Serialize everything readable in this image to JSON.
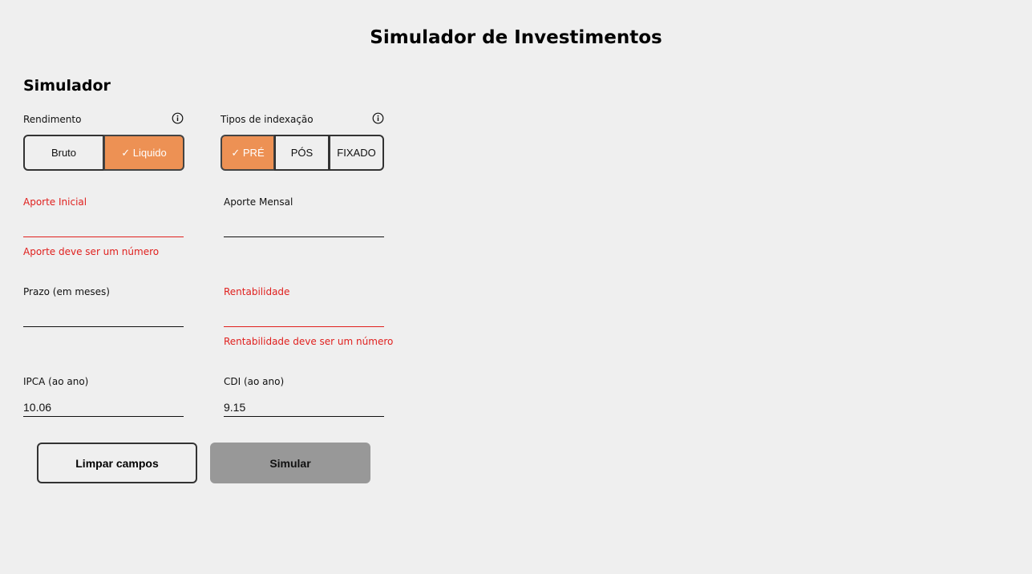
{
  "header": {
    "title": "Simulador de Investimentos"
  },
  "simulator": {
    "title": "Simulador",
    "rendimento": {
      "label": "Rendimento",
      "options": [
        {
          "label": "Bruto",
          "active": false
        },
        {
          "label": "✓ Liquido",
          "active": true
        }
      ]
    },
    "indexacao": {
      "label": "Tipos de indexação",
      "options": [
        {
          "label": "✓ PRÉ",
          "active": true
        },
        {
          "label": "PÓS",
          "active": false
        },
        {
          "label": "FIXADO",
          "active": false
        }
      ]
    },
    "fields": {
      "aporte_inicial": {
        "label": "Aporte Inicial",
        "value": "",
        "error": "Aporte deve ser um número"
      },
      "aporte_mensal": {
        "label": "Aporte Mensal",
        "value": ""
      },
      "prazo": {
        "label": "Prazo (em meses)",
        "value": ""
      },
      "rentabilidade": {
        "label": "Rentabilidade",
        "value": "",
        "error": "Rentabilidade deve ser um número"
      },
      "ipca": {
        "label": "IPCA (ao ano)",
        "value": "10.06"
      },
      "cdi": {
        "label": "CDI (ao ano)",
        "value": "9.15"
      }
    },
    "actions": {
      "clear_label": "Limpar campos",
      "simulate_label": "Simular"
    }
  },
  "colors": {
    "accent": "#ed9154",
    "error": "#e0201e",
    "background": "#efefef",
    "disabled_button": "#989898"
  },
  "icons": {
    "info": "info-icon"
  }
}
